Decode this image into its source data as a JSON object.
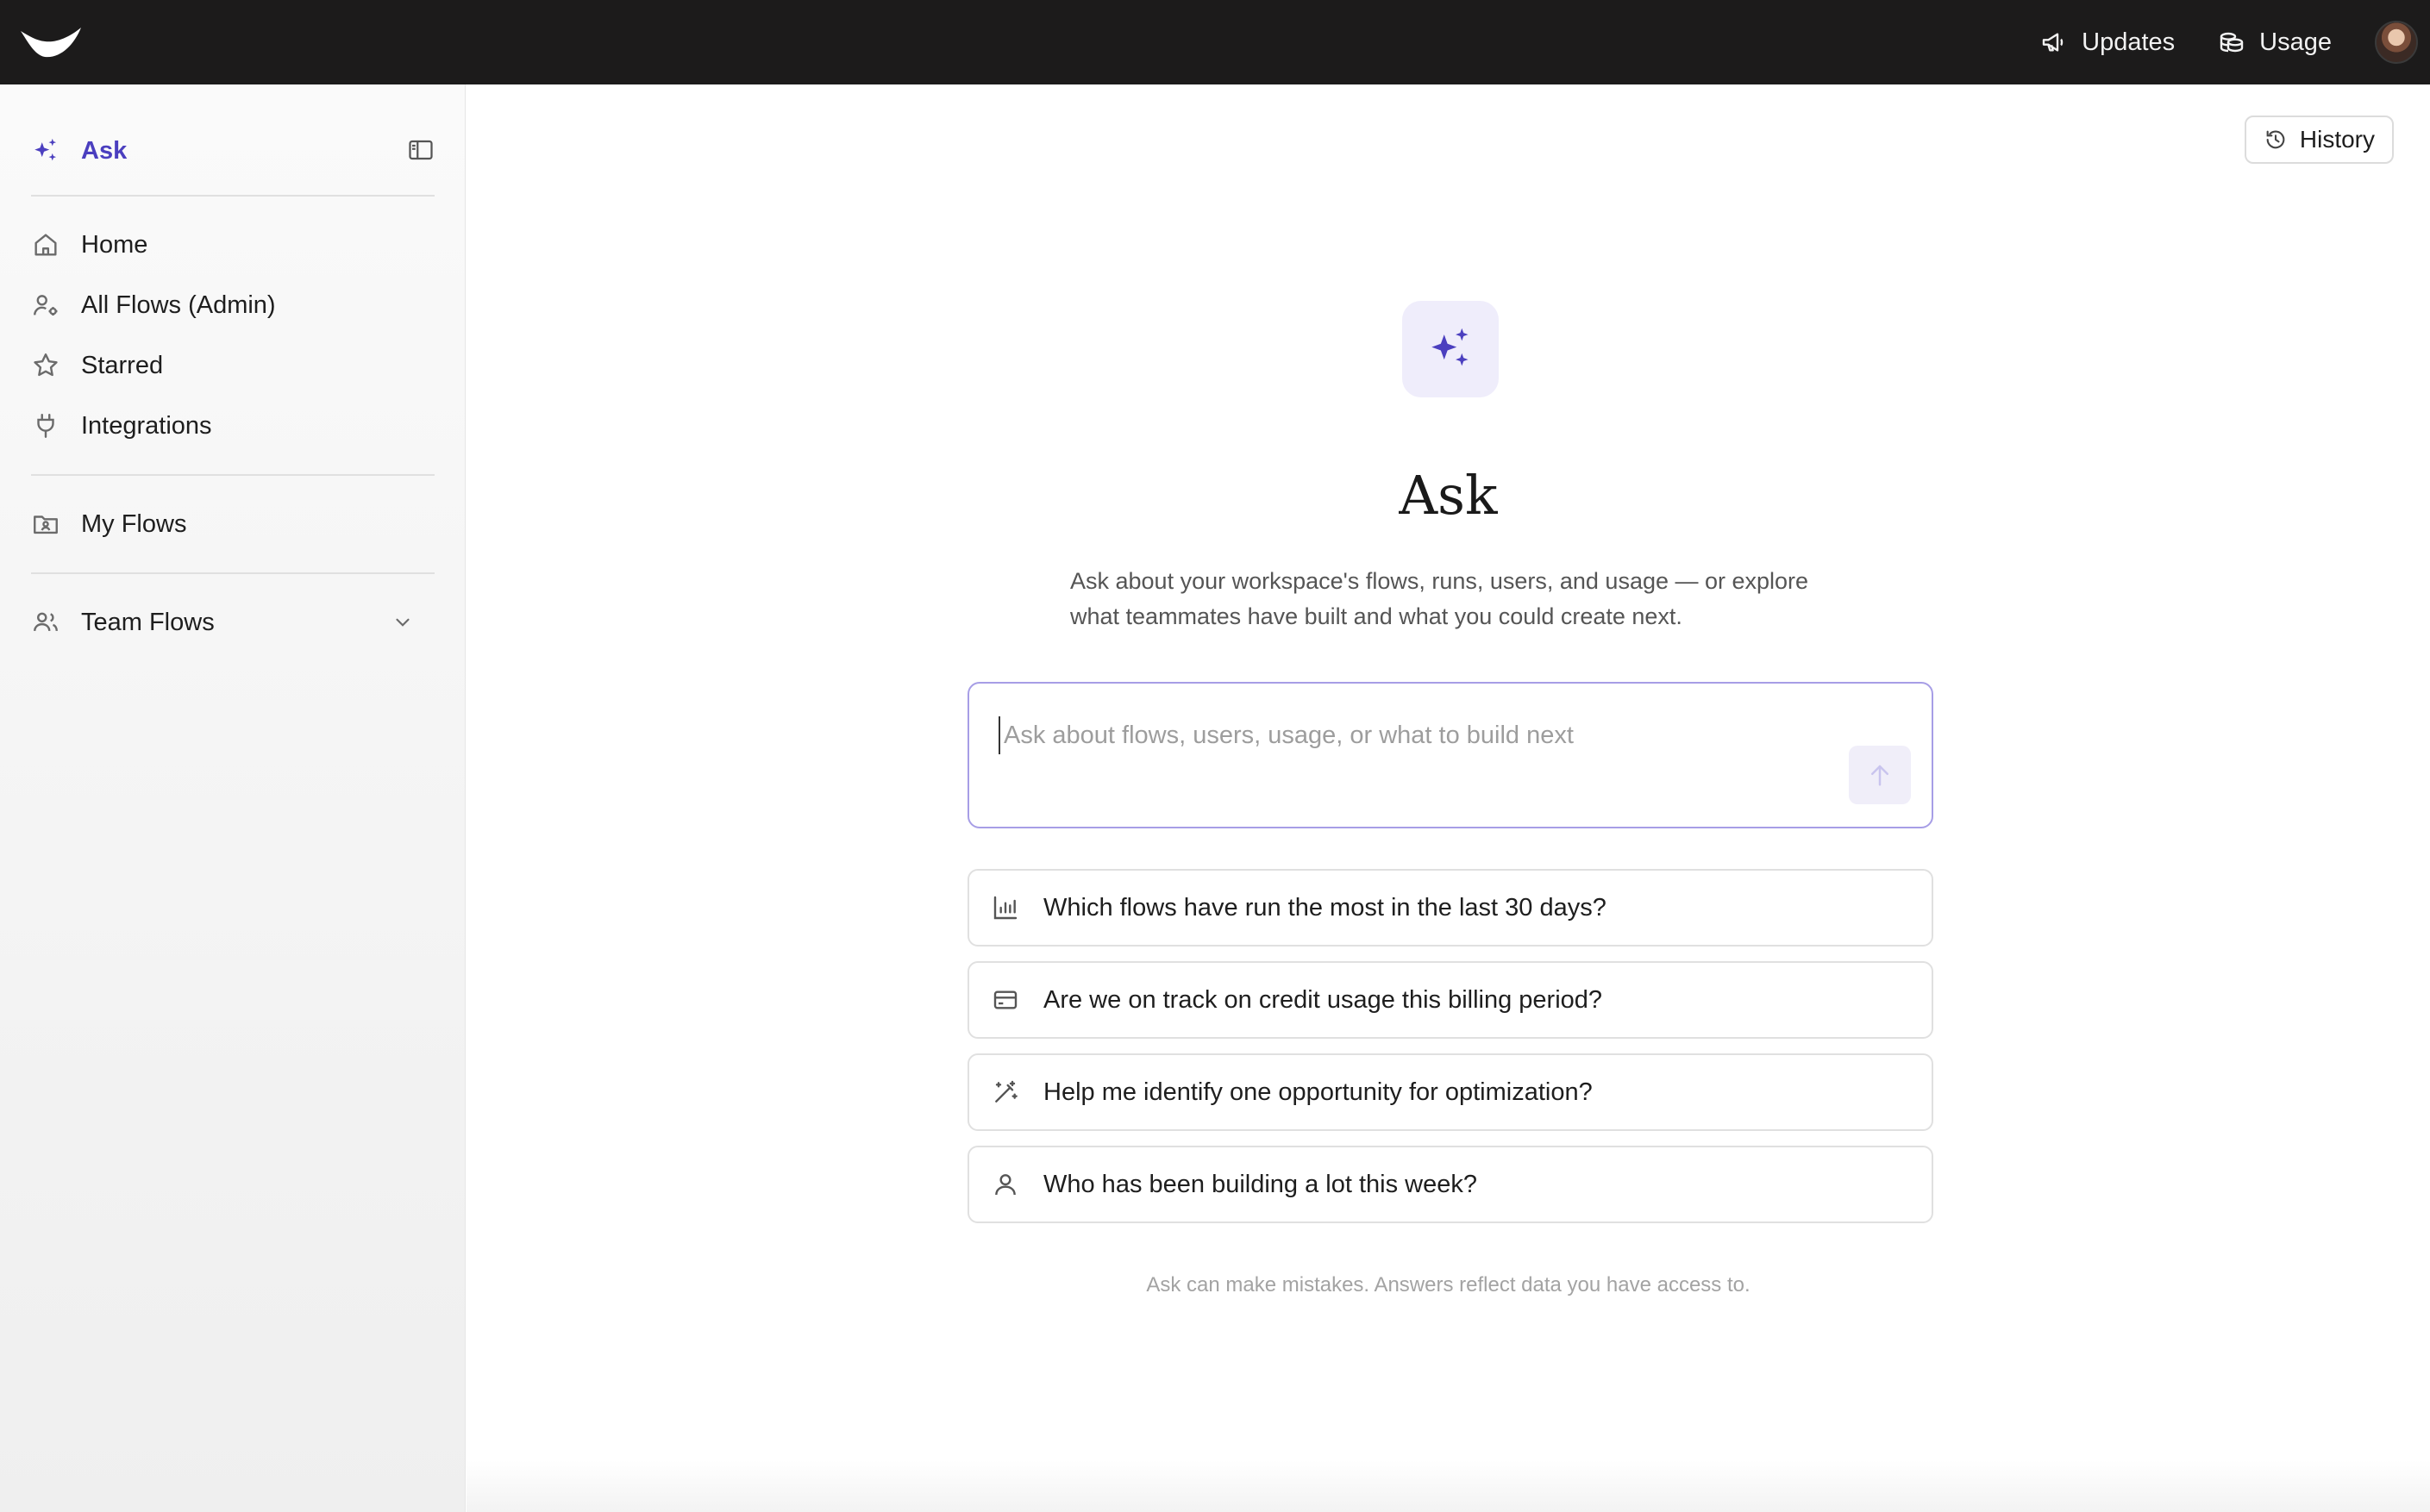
{
  "topbar": {
    "updates_label": "Updates",
    "usage_label": "Usage"
  },
  "sidebar": {
    "active_label": "Ask",
    "items": [
      {
        "label": "Home",
        "icon": "home-icon"
      },
      {
        "label": "All Flows (Admin)",
        "icon": "user-gear-icon"
      },
      {
        "label": "Starred",
        "icon": "star-icon"
      },
      {
        "label": "Integrations",
        "icon": "plug-icon"
      }
    ],
    "my_flows_label": "My Flows",
    "team_flows_label": "Team Flows"
  },
  "main": {
    "history_label": "History",
    "title": "Ask",
    "description": "Ask about your workspace's flows, runs, users, and usage — or explore what teammates have built and what you could create next.",
    "prompt": {
      "placeholder": "Ask about flows, users, usage, or what to build next",
      "value": ""
    },
    "suggestions": [
      {
        "label": "Which flows have run the most in the last 30 days?",
        "icon": "bar-chart-icon"
      },
      {
        "label": "Are we on track on credit usage this billing period?",
        "icon": "credit-card-icon"
      },
      {
        "label": "Help me identify one opportunity for optimization?",
        "icon": "magic-wand-icon"
      },
      {
        "label": "Who has been building a lot this week?",
        "icon": "user-icon"
      }
    ],
    "footnote": "Ask can make mistakes. Answers reflect data you have access to."
  },
  "colors": {
    "accent": "#4b3fbf",
    "topbar_bg": "#1c1b1b",
    "hero_icon_bg": "#efedfb",
    "prompt_border": "#a79ee6"
  }
}
